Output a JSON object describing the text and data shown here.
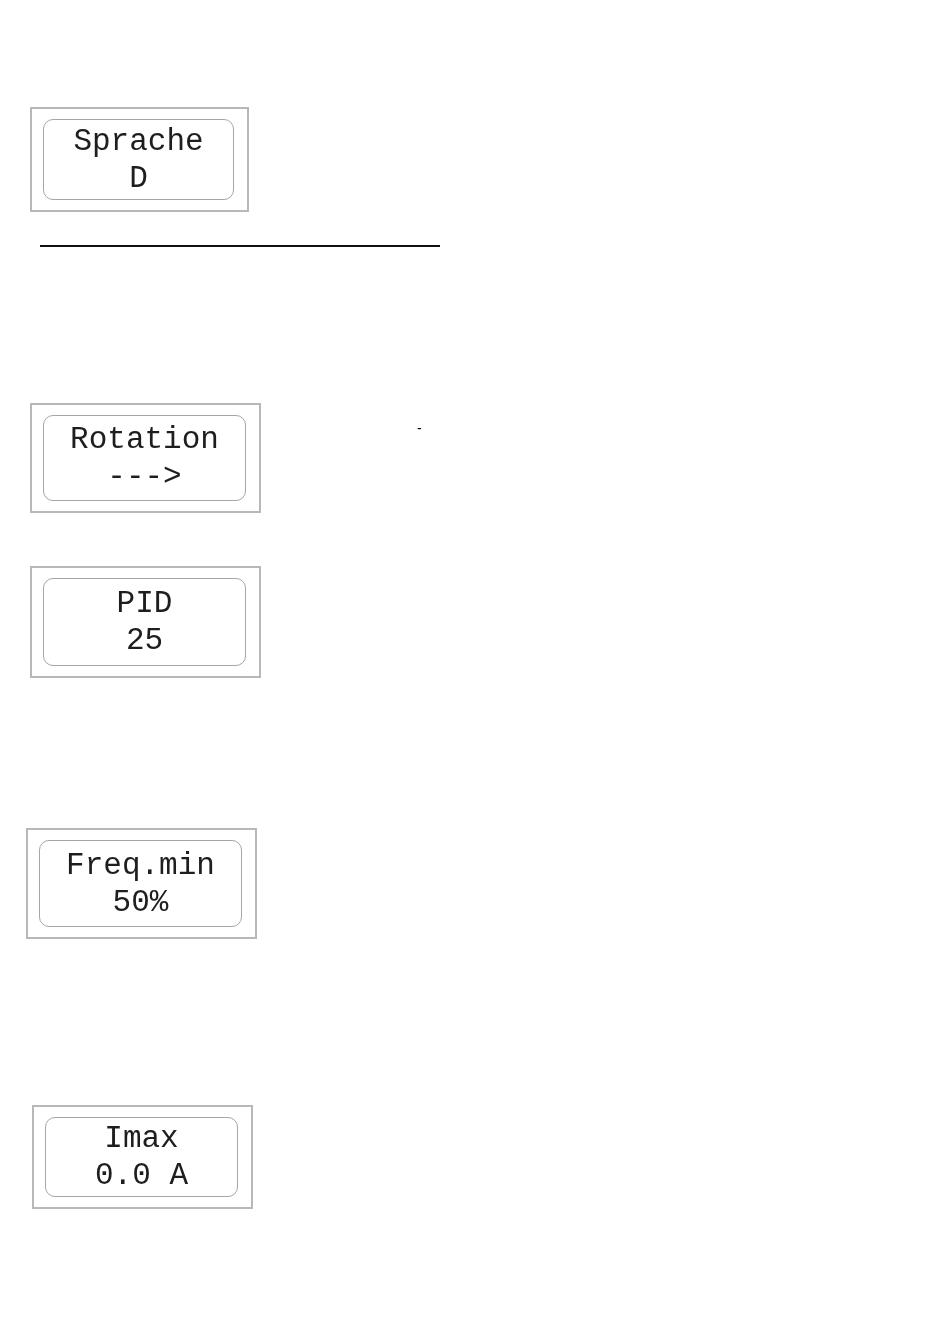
{
  "panels": [
    {
      "kind": "display",
      "label": "Sprache",
      "value": "D"
    },
    {
      "kind": "rule"
    },
    {
      "kind": "display",
      "label": "Rotation",
      "value": "--->",
      "note": "-"
    },
    {
      "kind": "display",
      "label": "PID",
      "value": "25"
    },
    {
      "kind": "display",
      "label": "Freq.min",
      "value": "50%"
    },
    {
      "kind": "display",
      "label": "Imax",
      "value": "0.0 A"
    }
  ]
}
